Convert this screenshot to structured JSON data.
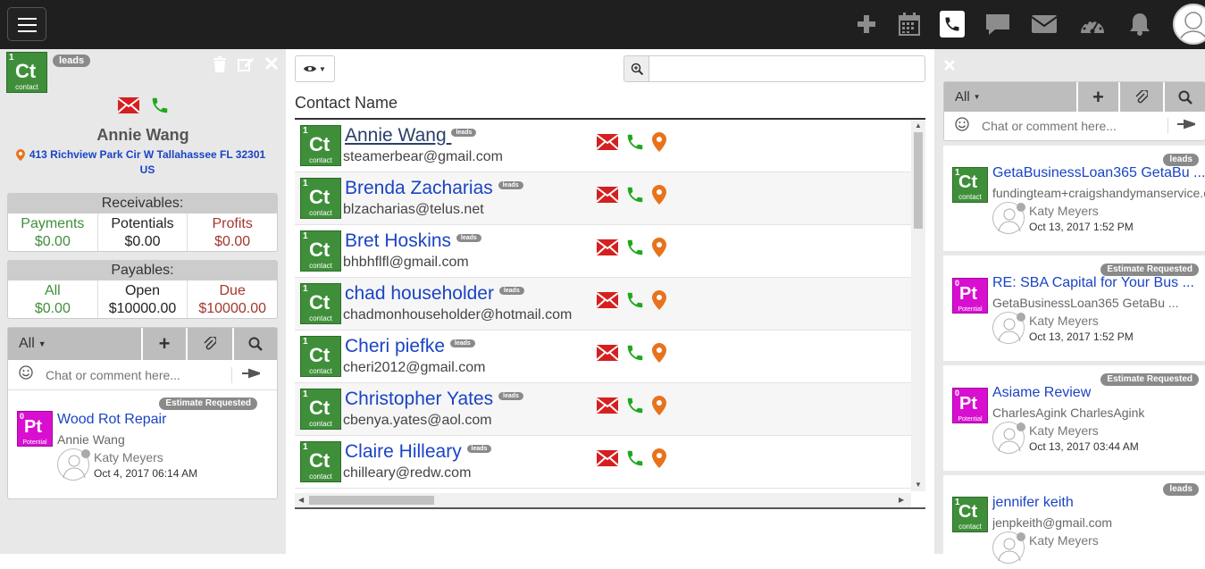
{
  "left": {
    "entity_badge": {
      "num": "1",
      "symbol": "Ct",
      "label": "contact"
    },
    "tag": "leads",
    "name": "Annie Wang",
    "address_line1": "413 Richview Park Cir W Tallahassee FL 32301",
    "address_line2": "US",
    "receivables": {
      "title": "Receivables:",
      "cols": [
        {
          "label": "Payments",
          "value": "$0.00"
        },
        {
          "label": "Potentials",
          "value": "$0.00"
        },
        {
          "label": "Profits",
          "value": "$0.00"
        }
      ]
    },
    "payables": {
      "title": "Payables:",
      "cols": [
        {
          "label": "All",
          "value": "$0.00"
        },
        {
          "label": "Open",
          "value": "$10000.00"
        },
        {
          "label": "Due",
          "value": "$10000.00"
        }
      ]
    },
    "chat": {
      "filter": "All",
      "placeholder": "Chat or comment here...",
      "items": [
        {
          "tag": "Estimate Requested",
          "badge": {
            "num": "0",
            "symbol": "Pt",
            "label": "Potential"
          },
          "title": "Wood Rot Repair",
          "subtitle": "Annie Wang",
          "user": "Katy Meyers",
          "time": "Oct 4, 2017 06:14 AM"
        }
      ]
    }
  },
  "center": {
    "column_header": "Contact Name",
    "search": {
      "placeholder": ""
    },
    "contacts": [
      {
        "name": "Annie Wang",
        "email": "steamerbear@gmail.com",
        "tag": "leads"
      },
      {
        "name": "Brenda Zacharias",
        "email": "blzacharias@telus.net",
        "tag": "leads"
      },
      {
        "name": "Bret Hoskins",
        "email": "bhbhflfl@gmail.com",
        "tag": "leads"
      },
      {
        "name": "chad householder",
        "email": "chadmonhouseholder@hotmail.com",
        "tag": "leads"
      },
      {
        "name": "Cheri piefke",
        "email": "cheri2012@gmail.com",
        "tag": "leads"
      },
      {
        "name": "Christopher Yates",
        "email": "cbenya.yates@aol.com",
        "tag": "leads"
      },
      {
        "name": "Claire Hilleary",
        "email": "chilleary@redw.com",
        "tag": "leads"
      }
    ],
    "badge": {
      "num": "1",
      "symbol": "Ct",
      "label": "contact"
    }
  },
  "right": {
    "chat": {
      "filter": "All",
      "placeholder": "Chat or comment here..."
    },
    "feed": [
      {
        "tag": "leads",
        "badge": {
          "num": "1",
          "symbol": "Ct",
          "label": "contact"
        },
        "title": "GetaBusinessLoan365 GetaBu ...",
        "subtitle": "fundingteam+craigshandymanservice.c",
        "user": "Katy Meyers",
        "time": "Oct 13, 2017 1:52 PM"
      },
      {
        "tag": "Estimate Requested",
        "badge": {
          "num": "0",
          "symbol": "Pt",
          "label": "Potential"
        },
        "title": "RE: SBA Capital for Your Bus ...",
        "subtitle": "GetaBusinessLoan365 GetaBu ...",
        "user": "Katy Meyers",
        "time": "Oct 13, 2017 1:52 PM"
      },
      {
        "tag": "Estimate Requested",
        "badge": {
          "num": "0",
          "symbol": "Pt",
          "label": "Potential"
        },
        "title": "Asiame Review",
        "subtitle": "CharlesAgink CharlesAgink",
        "user": "Katy Meyers",
        "time": "Oct 13, 2017 03:44 AM"
      },
      {
        "tag": "leads",
        "badge": {
          "num": "1",
          "symbol": "Ct",
          "label": "contact"
        },
        "title": "jennifer keith",
        "subtitle": "jenpkeith@gmail.com",
        "user": "Katy Meyers",
        "time": ""
      }
    ]
  },
  "colors": {
    "topbar": "#1f1f1f",
    "contact_green": "#3f8f3a",
    "potential_magenta": "#d80fd0",
    "link_blue": "#1a44c4",
    "email_red": "#d42020",
    "phone_green": "#1fa81f",
    "map_orange": "#e8731c"
  },
  "icons": {
    "top": [
      "hamburger-icon",
      "plus-icon",
      "calendar-icon",
      "phone-icon",
      "chat-icon",
      "envelope-icon",
      "dashboard-icon",
      "bell-icon",
      "user-avatar-icon"
    ],
    "row_actions": [
      "email-icon",
      "phone-icon",
      "map-marker-icon"
    ]
  }
}
